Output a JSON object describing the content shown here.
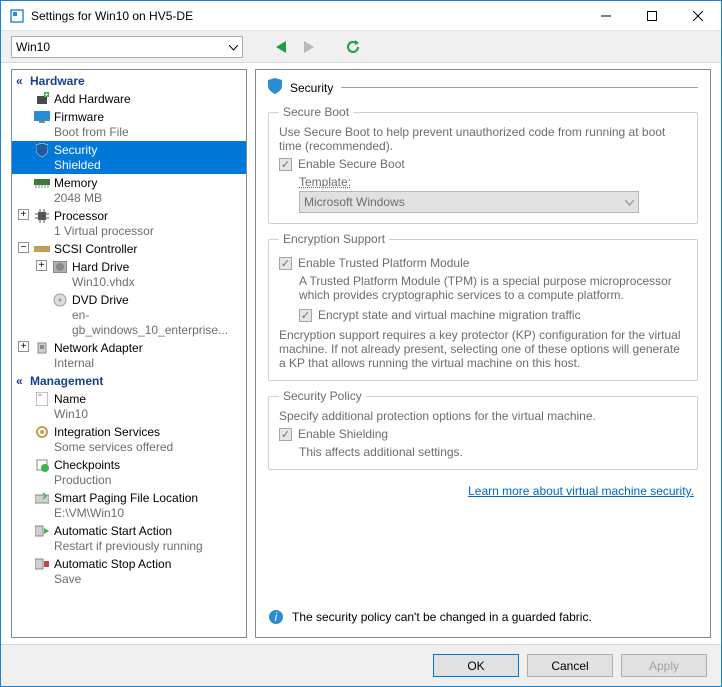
{
  "window": {
    "title": "Settings for Win10 on HV5-DE"
  },
  "toolbar": {
    "vm_selected": "Win10"
  },
  "tree": {
    "hardware_header": "Hardware",
    "management_header": "Management",
    "add_hardware": "Add Hardware",
    "firmware": "Firmware",
    "firmware_sub": "Boot from File",
    "security": "Security",
    "security_sub": "Shielded",
    "memory": "Memory",
    "memory_sub": "2048 MB",
    "processor": "Processor",
    "processor_sub": "1 Virtual processor",
    "scsi": "SCSI Controller",
    "hdd": "Hard Drive",
    "hdd_sub": "Win10.vhdx",
    "dvd": "DVD Drive",
    "dvd_sub": "en-gb_windows_10_enterprise...",
    "net": "Network Adapter",
    "net_sub": "Internal",
    "name": "Name",
    "name_sub": "Win10",
    "integ": "Integration Services",
    "integ_sub": "Some services offered",
    "check": "Checkpoints",
    "check_sub": "Production",
    "paging": "Smart Paging File Location",
    "paging_sub": "E:\\VM\\Win10",
    "astart": "Automatic Start Action",
    "astart_sub": "Restart if previously running",
    "astop": "Automatic Stop Action",
    "astop_sub": "Save"
  },
  "content": {
    "title": "Security",
    "secure_boot": {
      "legend": "Secure Boot",
      "desc": "Use Secure Boot to help prevent unauthorized code from running at boot time (recommended).",
      "enable_label": "Enable Secure Boot",
      "template_label": "Template:",
      "template_value": "Microsoft Windows"
    },
    "encryption": {
      "legend": "Encryption Support",
      "enable_tpm": "Enable Trusted Platform Module",
      "tpm_desc": "A Trusted Platform Module (TPM) is a special purpose microprocessor which provides cryptographic services to a compute platform.",
      "encrypt_traffic": "Encrypt state and virtual machine migration traffic",
      "kp_desc": "Encryption support requires a key protector (KP) configuration for the virtual machine. If not already present, selecting one of these options will generate a KP that allows running the virtual machine on this host."
    },
    "policy": {
      "legend": "Security Policy",
      "desc": "Specify additional protection options for the virtual machine.",
      "enable_shielding": "Enable Shielding",
      "affects": "This affects additional settings."
    },
    "learn_link": "Learn more about virtual machine security.",
    "info_msg": "The security policy can't be changed in a guarded fabric."
  },
  "footer": {
    "ok": "OK",
    "cancel": "Cancel",
    "apply": "Apply"
  }
}
